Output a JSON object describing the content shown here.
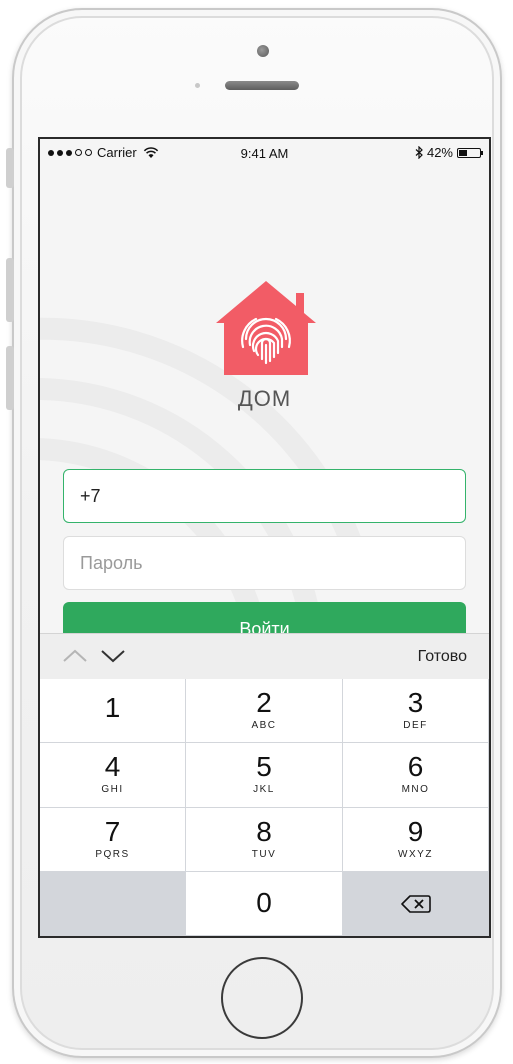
{
  "status_bar": {
    "carrier": "Carrier",
    "time": "9:41 AM",
    "battery": "42%",
    "battery_level": 0.42
  },
  "app": {
    "brand": "ДОМ",
    "logo_icon": "house-fingerprint-icon",
    "accent_color": "#f25c66"
  },
  "form": {
    "phone_value": "+7",
    "password_placeholder": "Пароль",
    "login_label": "Войти",
    "button_color": "#2fa95d"
  },
  "keyboard": {
    "done_label": "Готово",
    "keys": [
      {
        "digit": "1",
        "letters": ""
      },
      {
        "digit": "2",
        "letters": "ABC"
      },
      {
        "digit": "3",
        "letters": "DEF"
      },
      {
        "digit": "4",
        "letters": "GHI"
      },
      {
        "digit": "5",
        "letters": "JKL"
      },
      {
        "digit": "6",
        "letters": "MNO"
      },
      {
        "digit": "7",
        "letters": "PQRS"
      },
      {
        "digit": "8",
        "letters": "TUV"
      },
      {
        "digit": "9",
        "letters": "WXYZ"
      },
      {
        "digit": "0",
        "letters": ""
      }
    ]
  }
}
